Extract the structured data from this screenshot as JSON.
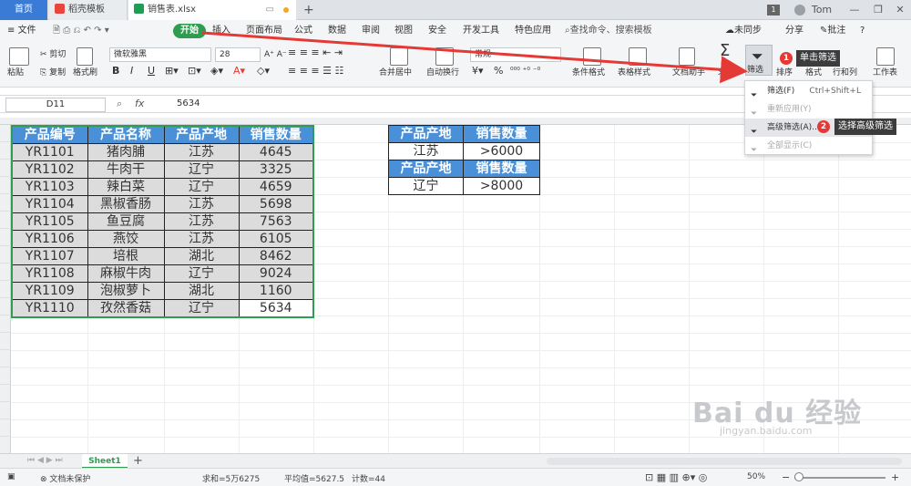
{
  "tabs": {
    "home": "首页",
    "template": "稻壳模板",
    "file": "销售表.xlsx",
    "new_tab": "+"
  },
  "window": {
    "badge": "1",
    "user": "Tom"
  },
  "menubar": {
    "file": "文件",
    "start": "开始",
    "insert": "插入",
    "layout": "页面布局",
    "formula": "公式",
    "data": "数据",
    "review": "审阅",
    "view": "视图",
    "security": "安全",
    "dev": "开发工具",
    "special": "特色应用",
    "search": "查找命令、搜索模板",
    "sync": "未同步",
    "share": "分享",
    "comment": "批注",
    "help": "?"
  },
  "ribbon": {
    "paste": "粘贴",
    "cut": "剪切",
    "copy": "复制",
    "format_painter": "格式刷",
    "font_name": "微软雅黑",
    "font_size": "28",
    "merge": "合并居中",
    "wrap": "自动换行",
    "number_format": "常规",
    "percent": "%",
    "cond_format": "条件格式",
    "table_style": "表格样式",
    "doc_helper": "文档助手",
    "sum": "求和",
    "filter": "筛选",
    "sort": "排序",
    "format": "格式",
    "rowcol": "行和列",
    "sheet": "工作表"
  },
  "formula_bar": {
    "cell": "D11",
    "fx": "fx",
    "value": "5634"
  },
  "main_table": {
    "headers": [
      "产品编号",
      "产品名称",
      "产品产地",
      "销售数量"
    ],
    "rows": [
      [
        "YR1101",
        "猪肉脯",
        "江苏",
        "4645"
      ],
      [
        "YR1102",
        "牛肉干",
        "辽宁",
        "3325"
      ],
      [
        "YR1103",
        "辣白菜",
        "辽宁",
        "4659"
      ],
      [
        "YR1104",
        "黑椒香肠",
        "江苏",
        "5698"
      ],
      [
        "YR1105",
        "鱼豆腐",
        "江苏",
        "7563"
      ],
      [
        "YR1106",
        "燕饺",
        "江苏",
        "6105"
      ],
      [
        "YR1107",
        "培根",
        "湖北",
        "8462"
      ],
      [
        "YR1108",
        "麻椒牛肉",
        "辽宁",
        "9024"
      ],
      [
        "YR1109",
        "泡椒萝卜",
        "湖北",
        "1160"
      ],
      [
        "YR1110",
        "孜然香菇",
        "辽宁",
        "5634"
      ]
    ]
  },
  "criteria_table": {
    "block1_headers": [
      "产品产地",
      "销售数量"
    ],
    "block1_row": [
      "江苏",
      ">6000"
    ],
    "block2_headers": [
      "产品产地",
      "销售数量"
    ],
    "block2_row": [
      "辽宁",
      ">8000"
    ]
  },
  "dropdown": {
    "filter": "筛选(F)",
    "filter_shortcut": "Ctrl+Shift+L",
    "reapply": "重新应用(Y)",
    "advanced": "高级筛选(A)...",
    "show_all": "全部显示(C)"
  },
  "callouts": {
    "step1_num": "1",
    "step1_text": "单击筛选",
    "step2_num": "2",
    "step2_text": "选择高级筛选"
  },
  "sheet_tabs": {
    "sheet1": "Sheet1",
    "add": "+"
  },
  "status_bar": {
    "doc_protect": "文档未保护",
    "sum": "求和=5万6275",
    "avg": "平均值=5627.5",
    "count": "计数=44",
    "zoom": "50%"
  },
  "watermark": {
    "logo": "Bai du 经验",
    "url": "jingyan.baidu.com"
  },
  "colors": {
    "header_blue": "#4a90d9",
    "accent_green": "#2e9d4f",
    "badge_red": "#e53935",
    "arrow_red": "#e53935"
  }
}
